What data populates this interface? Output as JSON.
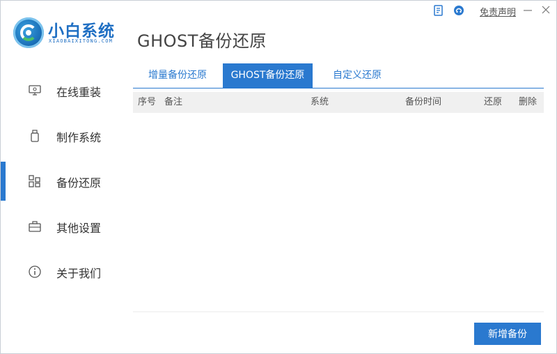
{
  "app": {
    "name": "小白系统",
    "subtitle": "XIAOBAIXITONG.COM"
  },
  "titlebar": {
    "disclaimer": "免责声明",
    "icons": [
      "document-icon",
      "support-icon",
      "minimize-icon",
      "close-icon"
    ]
  },
  "sidebar": {
    "items": [
      {
        "label": "在线重装",
        "icon": "monitor-icon",
        "active": false
      },
      {
        "label": "制作系统",
        "icon": "usb-drive-icon",
        "active": false
      },
      {
        "label": "备份还原",
        "icon": "grid-icon",
        "active": true
      },
      {
        "label": "其他设置",
        "icon": "toolbox-icon",
        "active": false
      },
      {
        "label": "关于我们",
        "icon": "info-icon",
        "active": false
      }
    ]
  },
  "main": {
    "title": "GHOST备份还原",
    "tabs": [
      {
        "label": "增量备份还原",
        "active": false
      },
      {
        "label": "GHOST备份还原",
        "active": true
      },
      {
        "label": "自定义还原",
        "active": false
      }
    ],
    "table": {
      "columns": [
        "序号",
        "备注",
        "系统",
        "备份时间",
        "还原",
        "删除"
      ],
      "rows": []
    },
    "new_backup_button": "新增备份"
  },
  "colors": {
    "accent": "#2a79cf",
    "header_bg": "#f0f0f0",
    "logo_blue": "#1f6fc3"
  }
}
